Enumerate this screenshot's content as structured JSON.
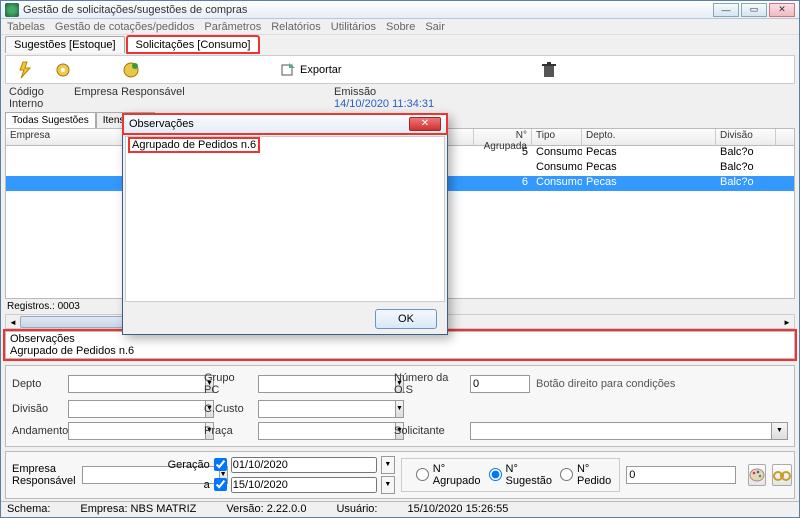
{
  "window": {
    "title": "Gestão de solicitações/sugestões de compras"
  },
  "menubar": [
    "Tabelas",
    "Gestão de cotações/pedidos",
    "Parâmetros",
    "Relatórios",
    "Utilitários",
    "Sobre",
    "Sair"
  ],
  "main_tabs": {
    "left": "Sugestões [Estoque]",
    "right": "Solicitações [Consumo]"
  },
  "toolbar": {
    "export": "Exportar"
  },
  "header_fields": {
    "codigo_label": "Código Interno",
    "empresa_label": "Empresa Responsável",
    "emissao_label": "Emissão",
    "emissao_value": "14/10/2020 11:34:31"
  },
  "inner_tabs": [
    "Todas Sugestões",
    "Itens da S"
  ],
  "grid": {
    "headers": {
      "empresa": "Empresa",
      "agrupada": "N° Agrupada",
      "tipo": "Tipo",
      "depto": "Depto.",
      "divisao": "Divisão"
    },
    "rows": [
      {
        "empresa": "",
        "agrupada": "5",
        "tipo": "Consumo",
        "depto": "Pecas",
        "divisao": "Balc?o"
      },
      {
        "empresa": "",
        "agrupada": "",
        "tipo": "Consumo",
        "depto": "Pecas",
        "divisao": "Balc?o"
      },
      {
        "empresa": "",
        "agrupada": "6",
        "tipo": "Consumo",
        "depto": "Pecas",
        "divisao": "Balc?o"
      }
    ]
  },
  "registros": "Registros.: 0003",
  "observacoes": {
    "label": "Observações",
    "text": "Agrupado de Pedidos n.6"
  },
  "filters": {
    "depto": "Depto",
    "grupo_pc": "Grupo PC",
    "numero_os": "Número da O.S",
    "numero_os_val": "0",
    "hint": "Botão direito para condições",
    "divisao": "Divisão",
    "ccusto": "C.Custo",
    "andamento": "Andamento",
    "praca": "Praça",
    "solicitante": "Solicitante"
  },
  "bottom": {
    "empresa_resp": "Empresa Responsável",
    "geracao": "Geração",
    "a": "a",
    "date_from": "01/10/2020",
    "date_to": "15/10/2020",
    "r_agrupado": "N° Agrupado",
    "r_sugestao": "N° Sugestão",
    "r_pedido": "N° Pedido",
    "num_val": "0"
  },
  "status": {
    "schema": "Schema:",
    "empresa": "Empresa: NBS MATRIZ",
    "versao": "Versão: 2.22.0.0",
    "usuario": "Usuário:",
    "datetime": "15/10/2020 15:26:55"
  },
  "dialog": {
    "title": "Observações",
    "body": "Agrupado de Pedidos n.6",
    "ok": "OK"
  }
}
